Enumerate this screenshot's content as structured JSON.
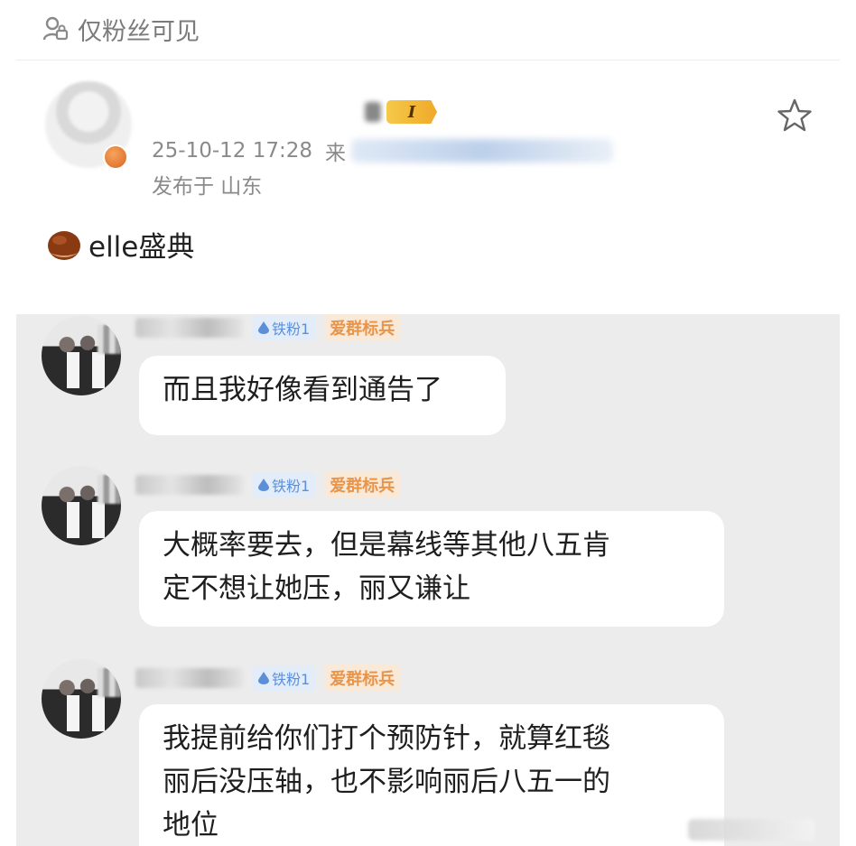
{
  "notice": {
    "icon": "lock-person-icon",
    "text": "仅粉丝可见"
  },
  "post": {
    "author_level": "I",
    "timestamp": "25-10-12 17:28",
    "source_prefix": "来",
    "location": "发布于 山东",
    "text": "elle盛典",
    "leading_emoji": "chestnut-emoji"
  },
  "chat": {
    "messages": [
      {
        "fan_level": "铁粉1",
        "group_badge": "爱群标兵",
        "text": "而且我好像看到通告了"
      },
      {
        "fan_level": "铁粉1",
        "group_badge": "爱群标兵",
        "text": "大概率要去，但是幕线等其他八五肯\n定不想让她压，丽又谦让"
      },
      {
        "fan_level": "铁粉1",
        "group_badge": "爱群标兵",
        "text": "我提前给你们打个预防针，就算红毯\n丽后没压轴，也不影响丽后八五一的\n地位"
      }
    ]
  },
  "colors": {
    "badge_blue": "#5d8fd9",
    "badge_orange": "#e8954a",
    "level_gold": "#f5c94a"
  }
}
